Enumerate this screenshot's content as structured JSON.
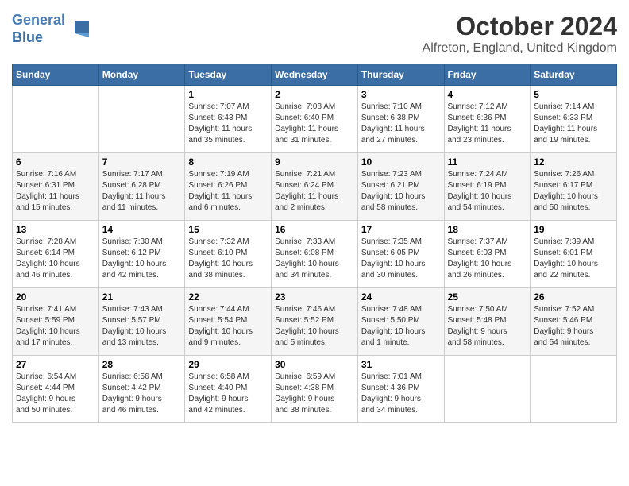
{
  "header": {
    "logo_line1": "General",
    "logo_line2": "Blue",
    "month_title": "October 2024",
    "location": "Alfreton, England, United Kingdom"
  },
  "days_of_week": [
    "Sunday",
    "Monday",
    "Tuesday",
    "Wednesday",
    "Thursday",
    "Friday",
    "Saturday"
  ],
  "weeks": [
    [
      {
        "day": "",
        "detail": ""
      },
      {
        "day": "",
        "detail": ""
      },
      {
        "day": "1",
        "detail": "Sunrise: 7:07 AM\nSunset: 6:43 PM\nDaylight: 11 hours\nand 35 minutes."
      },
      {
        "day": "2",
        "detail": "Sunrise: 7:08 AM\nSunset: 6:40 PM\nDaylight: 11 hours\nand 31 minutes."
      },
      {
        "day": "3",
        "detail": "Sunrise: 7:10 AM\nSunset: 6:38 PM\nDaylight: 11 hours\nand 27 minutes."
      },
      {
        "day": "4",
        "detail": "Sunrise: 7:12 AM\nSunset: 6:36 PM\nDaylight: 11 hours\nand 23 minutes."
      },
      {
        "day": "5",
        "detail": "Sunrise: 7:14 AM\nSunset: 6:33 PM\nDaylight: 11 hours\nand 19 minutes."
      }
    ],
    [
      {
        "day": "6",
        "detail": "Sunrise: 7:16 AM\nSunset: 6:31 PM\nDaylight: 11 hours\nand 15 minutes."
      },
      {
        "day": "7",
        "detail": "Sunrise: 7:17 AM\nSunset: 6:28 PM\nDaylight: 11 hours\nand 11 minutes."
      },
      {
        "day": "8",
        "detail": "Sunrise: 7:19 AM\nSunset: 6:26 PM\nDaylight: 11 hours\nand 6 minutes."
      },
      {
        "day": "9",
        "detail": "Sunrise: 7:21 AM\nSunset: 6:24 PM\nDaylight: 11 hours\nand 2 minutes."
      },
      {
        "day": "10",
        "detail": "Sunrise: 7:23 AM\nSunset: 6:21 PM\nDaylight: 10 hours\nand 58 minutes."
      },
      {
        "day": "11",
        "detail": "Sunrise: 7:24 AM\nSunset: 6:19 PM\nDaylight: 10 hours\nand 54 minutes."
      },
      {
        "day": "12",
        "detail": "Sunrise: 7:26 AM\nSunset: 6:17 PM\nDaylight: 10 hours\nand 50 minutes."
      }
    ],
    [
      {
        "day": "13",
        "detail": "Sunrise: 7:28 AM\nSunset: 6:14 PM\nDaylight: 10 hours\nand 46 minutes."
      },
      {
        "day": "14",
        "detail": "Sunrise: 7:30 AM\nSunset: 6:12 PM\nDaylight: 10 hours\nand 42 minutes."
      },
      {
        "day": "15",
        "detail": "Sunrise: 7:32 AM\nSunset: 6:10 PM\nDaylight: 10 hours\nand 38 minutes."
      },
      {
        "day": "16",
        "detail": "Sunrise: 7:33 AM\nSunset: 6:08 PM\nDaylight: 10 hours\nand 34 minutes."
      },
      {
        "day": "17",
        "detail": "Sunrise: 7:35 AM\nSunset: 6:05 PM\nDaylight: 10 hours\nand 30 minutes."
      },
      {
        "day": "18",
        "detail": "Sunrise: 7:37 AM\nSunset: 6:03 PM\nDaylight: 10 hours\nand 26 minutes."
      },
      {
        "day": "19",
        "detail": "Sunrise: 7:39 AM\nSunset: 6:01 PM\nDaylight: 10 hours\nand 22 minutes."
      }
    ],
    [
      {
        "day": "20",
        "detail": "Sunrise: 7:41 AM\nSunset: 5:59 PM\nDaylight: 10 hours\nand 17 minutes."
      },
      {
        "day": "21",
        "detail": "Sunrise: 7:43 AM\nSunset: 5:57 PM\nDaylight: 10 hours\nand 13 minutes."
      },
      {
        "day": "22",
        "detail": "Sunrise: 7:44 AM\nSunset: 5:54 PM\nDaylight: 10 hours\nand 9 minutes."
      },
      {
        "day": "23",
        "detail": "Sunrise: 7:46 AM\nSunset: 5:52 PM\nDaylight: 10 hours\nand 5 minutes."
      },
      {
        "day": "24",
        "detail": "Sunrise: 7:48 AM\nSunset: 5:50 PM\nDaylight: 10 hours\nand 1 minute."
      },
      {
        "day": "25",
        "detail": "Sunrise: 7:50 AM\nSunset: 5:48 PM\nDaylight: 9 hours\nand 58 minutes."
      },
      {
        "day": "26",
        "detail": "Sunrise: 7:52 AM\nSunset: 5:46 PM\nDaylight: 9 hours\nand 54 minutes."
      }
    ],
    [
      {
        "day": "27",
        "detail": "Sunrise: 6:54 AM\nSunset: 4:44 PM\nDaylight: 9 hours\nand 50 minutes."
      },
      {
        "day": "28",
        "detail": "Sunrise: 6:56 AM\nSunset: 4:42 PM\nDaylight: 9 hours\nand 46 minutes."
      },
      {
        "day": "29",
        "detail": "Sunrise: 6:58 AM\nSunset: 4:40 PM\nDaylight: 9 hours\nand 42 minutes."
      },
      {
        "day": "30",
        "detail": "Sunrise: 6:59 AM\nSunset: 4:38 PM\nDaylight: 9 hours\nand 38 minutes."
      },
      {
        "day": "31",
        "detail": "Sunrise: 7:01 AM\nSunset: 4:36 PM\nDaylight: 9 hours\nand 34 minutes."
      },
      {
        "day": "",
        "detail": ""
      },
      {
        "day": "",
        "detail": ""
      }
    ]
  ]
}
